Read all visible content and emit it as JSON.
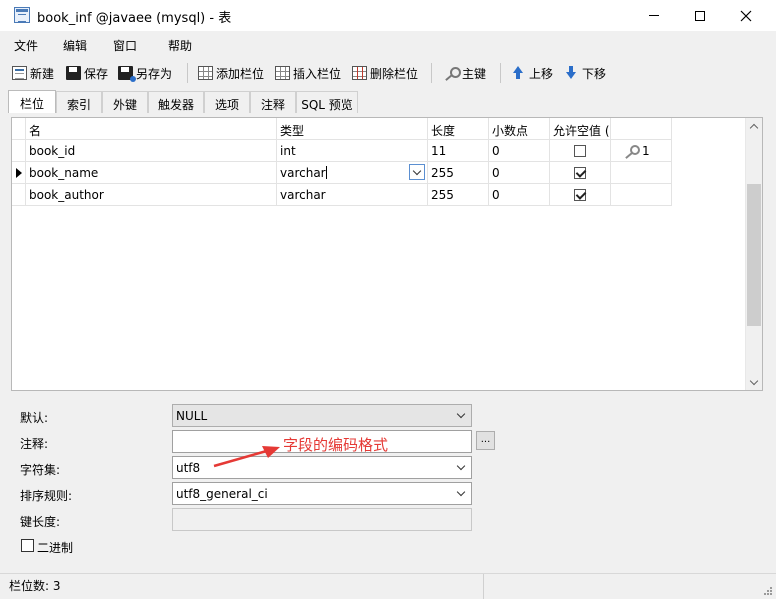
{
  "window": {
    "title": "book_inf @javaee (mysql) - 表"
  },
  "menu": [
    "文件",
    "编辑",
    "窗口",
    "帮助"
  ],
  "toolbar": {
    "new": "新建",
    "save": "保存",
    "save_as": "另存为",
    "add_column": "添加栏位",
    "insert_column": "插入栏位",
    "delete_column": "删除栏位",
    "primary_key": "主键",
    "move_up": "上移",
    "move_down": "下移"
  },
  "tabs": [
    "栏位",
    "索引",
    "外键",
    "触发器",
    "选项",
    "注释",
    "SQL 预览"
  ],
  "grid": {
    "headers": [
      "名",
      "类型",
      "长度",
      "小数点",
      "允许空值 ("
    ],
    "rows": [
      {
        "name": "book_id",
        "type": "int",
        "length": "11",
        "decimals": "0",
        "nullable": false,
        "key": "1"
      },
      {
        "name": "book_name",
        "type": "varchar",
        "length": "255",
        "decimals": "0",
        "nullable": true,
        "key": ""
      },
      {
        "name": "book_author",
        "type": "varchar",
        "length": "255",
        "decimals": "0",
        "nullable": true,
        "key": ""
      }
    ]
  },
  "props": {
    "default_label": "默认:",
    "default_value": "NULL",
    "comment_label": "注释:",
    "comment_value": "",
    "ellipsis": "...",
    "charset_label": "字符集:",
    "charset_value": "utf8",
    "collation_label": "排序规则:",
    "collation_value": "utf8_general_ci",
    "key_length_label": "键长度:",
    "key_length_value": "",
    "binary_label": "二进制"
  },
  "annotation": {
    "text": "字段的编码格式",
    "color": "#e53935"
  },
  "status": {
    "text": "栏位数: 3"
  }
}
